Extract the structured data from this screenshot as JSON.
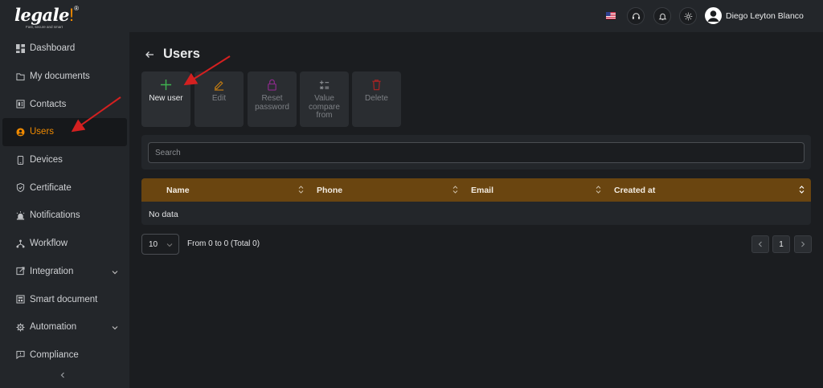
{
  "logo": {
    "name": "legale",
    "tagline": "Fast, secure and smart"
  },
  "sidebar": {
    "items": [
      {
        "label": "Dashboard",
        "icon": "dashboard-icon"
      },
      {
        "label": "My documents",
        "icon": "folder-icon"
      },
      {
        "label": "Contacts",
        "icon": "contacts-icon"
      },
      {
        "label": "Users",
        "icon": "user-circle-icon",
        "active": true
      },
      {
        "label": "Devices",
        "icon": "device-icon"
      },
      {
        "label": "Certificate",
        "icon": "shield-check-icon"
      },
      {
        "label": "Notifications",
        "icon": "alarm-icon"
      },
      {
        "label": "Workflow",
        "icon": "workflow-icon"
      },
      {
        "label": "Integration",
        "icon": "integration-icon",
        "expandable": true
      },
      {
        "label": "Smart document",
        "icon": "smart-document-icon"
      },
      {
        "label": "Automation",
        "icon": "automation-icon",
        "expandable": true
      },
      {
        "label": "Compliance",
        "icon": "comment-icon"
      }
    ],
    "collapse_icon": "chevron-left-icon"
  },
  "topbar": {
    "user_name": "Diego Leyton Blanco",
    "icons": [
      "us-flag-icon",
      "support-icon",
      "bell-icon",
      "sun-icon",
      "avatar-icon"
    ]
  },
  "page": {
    "title": "Users"
  },
  "actions": [
    {
      "label": "New user",
      "icon": "plus-icon",
      "enabled": true
    },
    {
      "label": "Edit",
      "icon": "pencil-icon",
      "enabled": false
    },
    {
      "label": "Reset password",
      "icon": "lock-icon",
      "enabled": false
    },
    {
      "label": "Value compare from",
      "icon": "compare-icon",
      "enabled": false
    },
    {
      "label": "Delete",
      "icon": "trash-icon",
      "enabled": false
    }
  ],
  "search": {
    "placeholder": "Search"
  },
  "table": {
    "columns": [
      "Name",
      "Phone",
      "Email",
      "Created at"
    ],
    "empty_text": "No data"
  },
  "pagination": {
    "page_size": "10",
    "range_text": "From 0 to 0 (Total 0)",
    "current_page": "1"
  },
  "colors": {
    "accent": "#f08a00",
    "table_header": "#6a4510",
    "sidebar_bg": "#23262a",
    "page_bg": "#1b1d20",
    "annotation_arrow": "#d42020"
  }
}
